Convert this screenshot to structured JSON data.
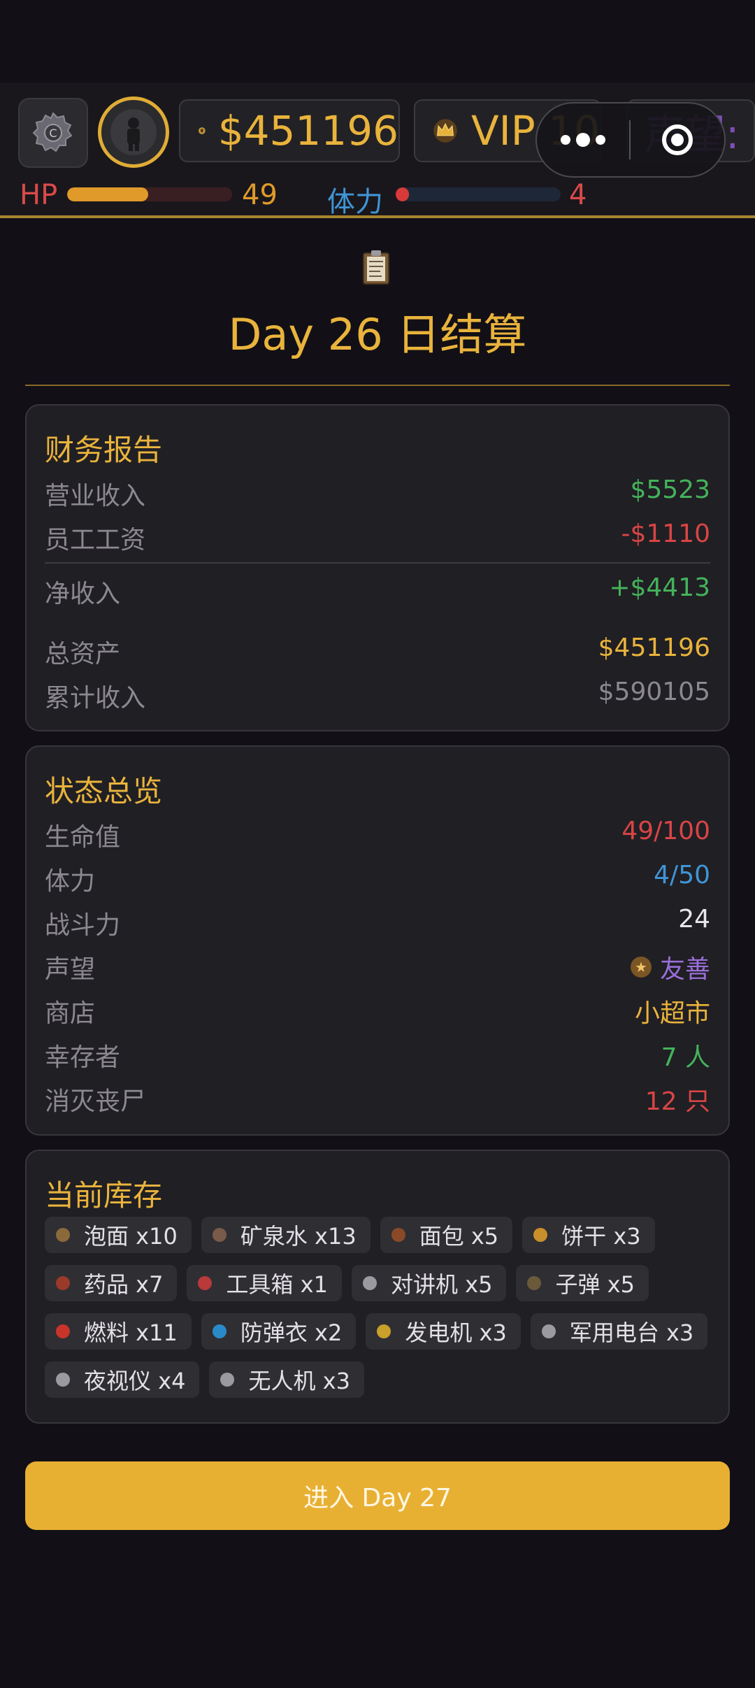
{
  "topbar": {
    "money": "$451196",
    "vip": "VIP 10",
    "reputation_label": "声望:"
  },
  "stats": {
    "hp_label": "HP",
    "hp_value": "49",
    "hp_fraction": 0.49,
    "stamina_label": "体力",
    "stamina_value": "4",
    "stamina_fraction": 0.08
  },
  "header": {
    "title": "Day 26 日结算"
  },
  "finance": {
    "title": "财务报告",
    "rows": [
      {
        "label": "营业收入",
        "value": "$5523"
      },
      {
        "label": "员工工资",
        "value": "-$1110"
      },
      {
        "label": "净收入",
        "value": "+$4413"
      },
      {
        "label": "总资产",
        "value": "$451196"
      },
      {
        "label": "累计收入",
        "value": "$590105"
      }
    ]
  },
  "status": {
    "title": "状态总览",
    "rows": [
      {
        "label": "生命值",
        "value": "49/100"
      },
      {
        "label": "体力",
        "value": "4/50"
      },
      {
        "label": "战斗力",
        "value": "24"
      },
      {
        "label": "声望",
        "value": "友善"
      },
      {
        "label": "商店",
        "value": "小超市"
      },
      {
        "label": "幸存者",
        "value": "7 人"
      },
      {
        "label": "消灭丧尸",
        "value": "12 只"
      }
    ]
  },
  "inventory": {
    "title": "当前库存",
    "items": [
      {
        "label": "泡面 x10",
        "icon": "noodle-icon",
        "color": "#8a6a3a"
      },
      {
        "label": "矿泉水 x13",
        "icon": "water-icon",
        "color": "#7a5a48"
      },
      {
        "label": "面包 x5",
        "icon": "bread-icon",
        "color": "#8a4a28"
      },
      {
        "label": "饼干 x3",
        "icon": "biscuit-icon",
        "color": "#c8902a"
      },
      {
        "label": "药品 x7",
        "icon": "medicine-icon",
        "color": "#9a3a2a"
      },
      {
        "label": "工具箱 x1",
        "icon": "toolbox-icon",
        "color": "#b83a3a"
      },
      {
        "label": "对讲机 x5",
        "icon": "walkie-talkie-icon",
        "color": "#9a9aa0"
      },
      {
        "label": "子弹 x5",
        "icon": "bullet-icon",
        "color": "#6a5a3a"
      },
      {
        "label": "燃料 x11",
        "icon": "fuel-icon",
        "color": "#c8342a"
      },
      {
        "label": "防弹衣 x2",
        "icon": "vest-icon",
        "color": "#2a8ac8"
      },
      {
        "label": "发电机 x3",
        "icon": "generator-icon",
        "color": "#c8a02a"
      },
      {
        "label": "军用电台 x3",
        "icon": "radio-icon",
        "color": "#9a9aa0"
      },
      {
        "label": "夜视仪 x4",
        "icon": "night-vision-icon",
        "color": "#9a9aa0"
      },
      {
        "label": "无人机 x3",
        "icon": "drone-icon",
        "color": "#9a9aa0"
      }
    ]
  },
  "footer": {
    "enter_button": "进入 Day 27"
  }
}
